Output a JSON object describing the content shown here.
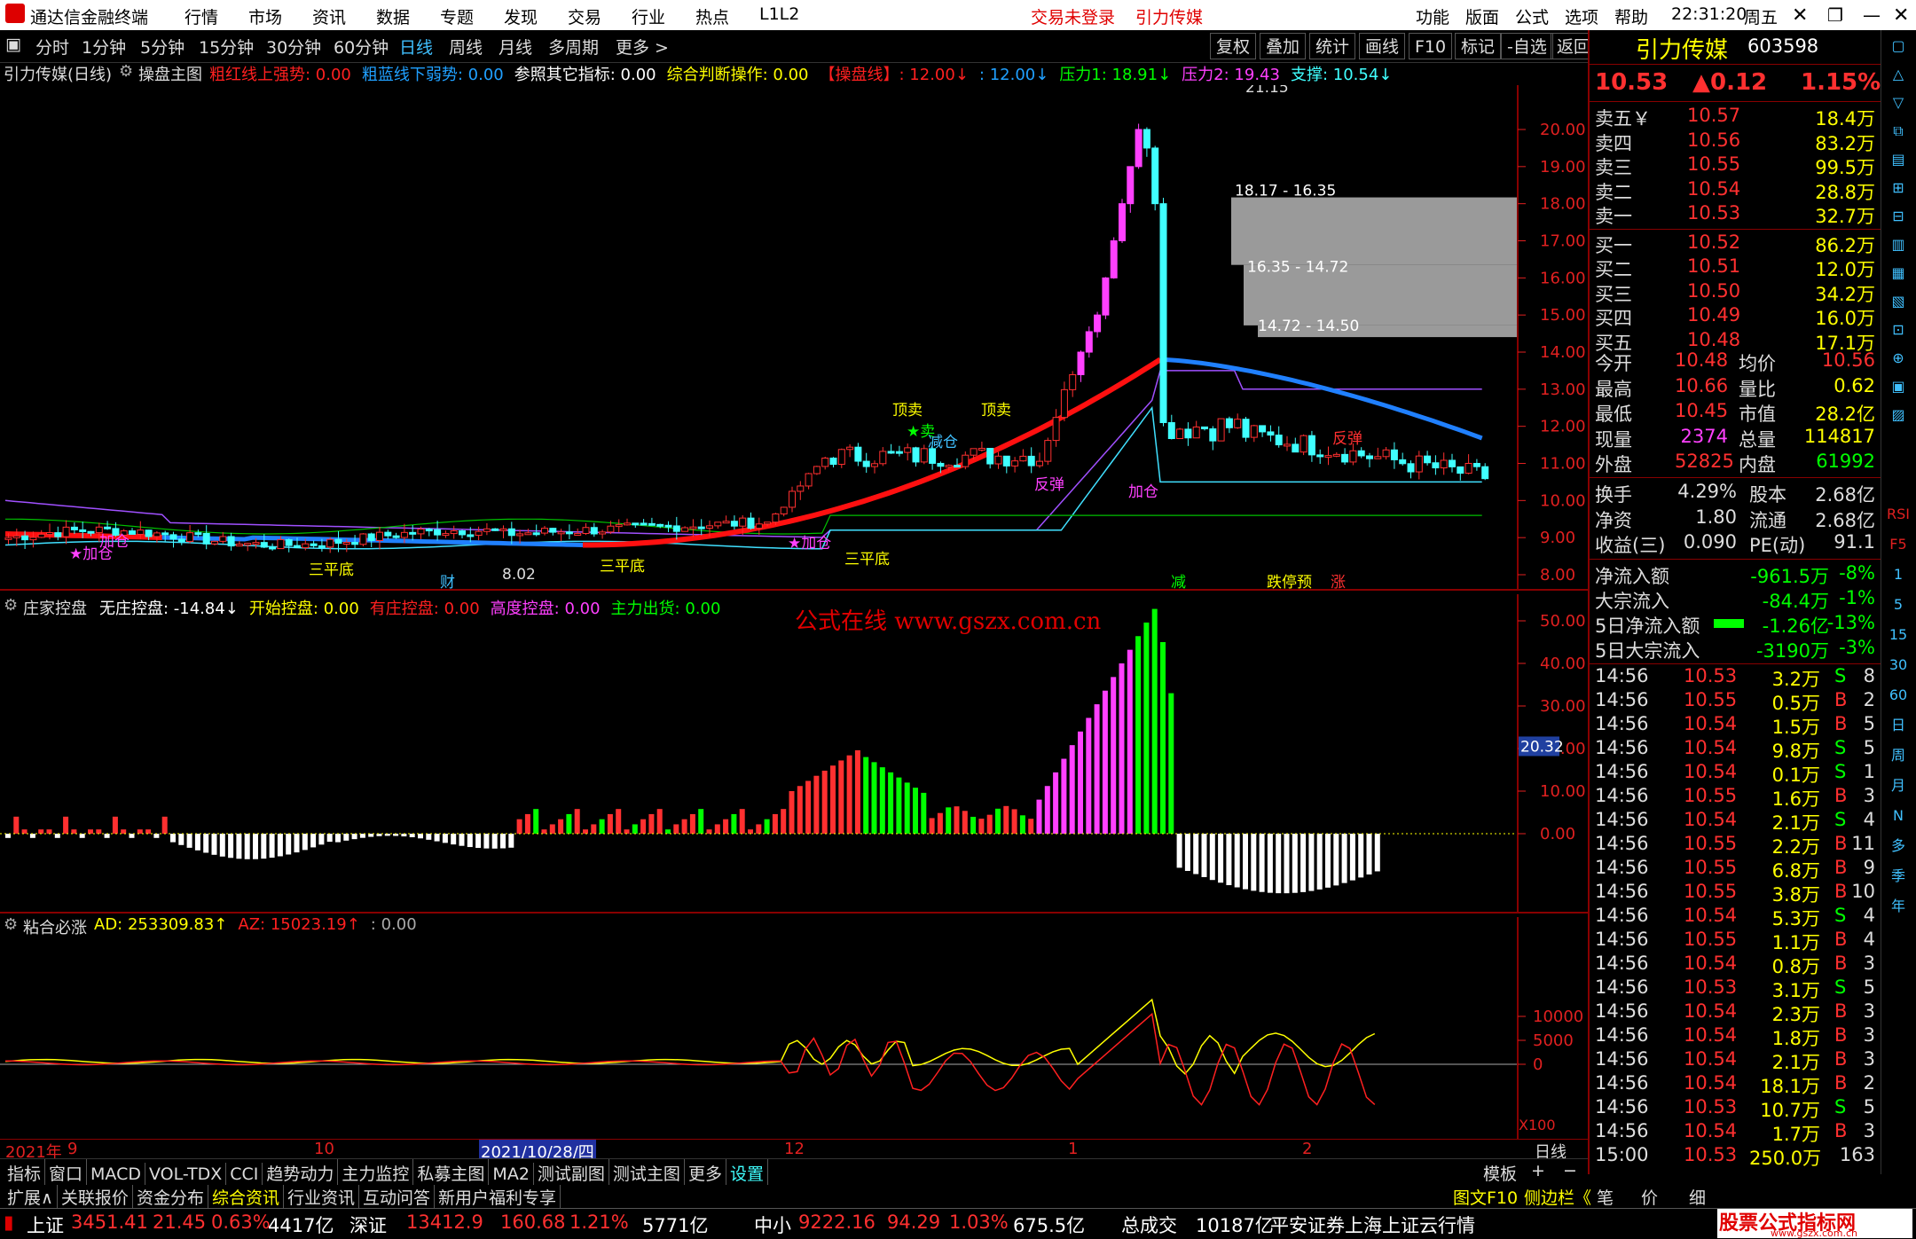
{
  "app": {
    "title": "通达信金融终端",
    "menus": [
      "行情",
      "市场",
      "资讯",
      "数据",
      "专题",
      "发现",
      "交易",
      "行业",
      "热点",
      "L1L2"
    ],
    "trade_status": "交易未登录",
    "stock_name_title": "引力传媒",
    "right_menus": [
      "功能",
      "版面",
      "公式",
      "选项",
      "帮助"
    ],
    "clock": "22:31:20",
    "weekday": "周五"
  },
  "periods": [
    "分时",
    "1分钟",
    "5分钟",
    "15分钟",
    "30分钟",
    "60分钟",
    "日线",
    "周线",
    "月线",
    "多周期",
    "更多 >"
  ],
  "selected_period": "日线",
  "tool_buttons": [
    "复权",
    "叠加",
    "统计",
    "画线",
    "F10",
    "标记",
    "-自选",
    "返回"
  ],
  "main_chart": {
    "title": "引力传媒(日线)",
    "indicator_name": "操盘主图",
    "legend": [
      {
        "text": "粗红线上强势: 0.00",
        "color": "#ff2020"
      },
      {
        "text": "粗蓝线下弱势: 0.00",
        "color": "#20a0ff"
      },
      {
        "text": "参照其它指标: 0.00",
        "color": "#ffffff"
      },
      {
        "text": "综合判断操作: 0.00",
        "color": "#ffff00"
      },
      {
        "text": "【操盘线】: 12.00↓",
        "color": "#ff2020"
      },
      {
        "text": ": 12.00↓",
        "color": "#20a0ff"
      },
      {
        "text": "压力1: 18.91↓",
        "color": "#00ff00"
      },
      {
        "text": "压力2: 19.43",
        "color": "#ff40ff"
      },
      {
        "text": "支撑: 10.54↓",
        "color": "#40ffff"
      }
    ],
    "high_label": "21.15",
    "low_label": "8.02",
    "zones": [
      "18.17 - 16.35",
      "16.35 - 14.72",
      "14.72 - 14.50"
    ],
    "y_ticks": [
      "20.00",
      "19.00",
      "18.00",
      "17.00",
      "16.00",
      "15.00",
      "14.00",
      "13.00",
      "12.00",
      "11.00",
      "10.00",
      "9.00",
      "8.00"
    ],
    "signals": [
      "顶卖",
      "顶卖",
      "★卖",
      "减仓",
      "反弹",
      "加仓",
      "★加仓",
      "加仓",
      "三平底",
      "三平底",
      "三平底",
      "★加仓",
      "反弹",
      "减",
      "跌停预",
      "涨",
      "财"
    ]
  },
  "mid_chart": {
    "indicator_name": "庄家控盘",
    "legend": [
      {
        "text": "无庄控盘: -14.84↓",
        "color": "#ffffff"
      },
      {
        "text": "开始控盘: 0.00",
        "color": "#ffff00"
      },
      {
        "text": "有庄控盘: 0.00",
        "color": "#ff2020"
      },
      {
        "text": "高度控盘: 0.00",
        "color": "#ff40ff"
      },
      {
        "text": "主力出货: 0.00",
        "color": "#00ff00"
      }
    ],
    "watermark": "公式在线 www.gszx.com.cn",
    "y_ticks": [
      "50.00",
      "40.00",
      "30.00",
      "20.00",
      "10.00",
      "0.00"
    ],
    "current_value": "20.32"
  },
  "low_chart": {
    "indicator_name": "粘合必涨",
    "legend": [
      {
        "text": "AD: 253309.83↑",
        "color": "#ffff00"
      },
      {
        "text": "AZ: 15023.19↑",
        "color": "#ff2020"
      },
      {
        "text": ": 0.00",
        "color": "#aaaaaa"
      }
    ],
    "y_ticks": [
      "10000",
      "5000",
      "0"
    ],
    "scale": "X100"
  },
  "x_axis": {
    "labels": [
      "2021年",
      "9",
      "10",
      "2021/10/28/四",
      "12",
      "1",
      "2"
    ],
    "right": "日线"
  },
  "bottom_tabs": [
    "指标",
    "窗口",
    "MACD",
    "VOL-TDX",
    "CCI",
    "趋势动力",
    "主力监控",
    "私募主图",
    "MA2",
    "测试副图",
    "测试主图",
    "更多",
    "设置"
  ],
  "bottom_right": [
    "模板",
    "+",
    "−"
  ],
  "bottom_tabs2": [
    "扩展∧",
    "关联报价",
    "资金分布",
    "综合资讯",
    "行业资讯",
    "互动问答",
    "新用户福利专享"
  ],
  "bottom_right2": [
    "图文F10",
    "侧边栏《",
    "笔",
    "价",
    "细"
  ],
  "quote": {
    "name": "引力传媒",
    "code": "603598",
    "price": "10.53",
    "change": "▲0.12",
    "pct": "1.15%",
    "asks": [
      [
        "卖五￥",
        "10.57",
        "18.4万"
      ],
      [
        "卖四",
        "10.56",
        "83.2万"
      ],
      [
        "卖三",
        "10.55",
        "99.5万"
      ],
      [
        "卖二",
        "10.54",
        "28.8万"
      ],
      [
        "卖一",
        "10.53",
        "32.7万"
      ]
    ],
    "bids": [
      [
        "买一",
        "10.52",
        "86.2万"
      ],
      [
        "买二",
        "10.51",
        "12.0万"
      ],
      [
        "买三",
        "10.50",
        "34.2万"
      ],
      [
        "买四",
        "10.49",
        "16.0万"
      ],
      [
        "买五",
        "10.48",
        "17.1万"
      ]
    ],
    "stats": [
      [
        "今开",
        "10.48",
        "均价",
        "10.56"
      ],
      [
        "最高",
        "10.66",
        "量比",
        "0.62"
      ],
      [
        "最低",
        "10.45",
        "市值",
        "28.2亿"
      ],
      [
        "现量",
        "2374",
        "总量",
        "114817"
      ],
      [
        "外盘",
        "52825",
        "内盘",
        "61992"
      ]
    ],
    "stats2": [
      [
        "换手",
        "4.29%",
        "股本",
        "2.68亿"
      ],
      [
        "净资",
        "1.80",
        "流通",
        "2.68亿"
      ],
      [
        "收益(三)",
        "0.090",
        "PE(动)",
        "91.1"
      ]
    ],
    "flows": [
      [
        "净流入额",
        "-961.5万",
        "-8%"
      ],
      [
        "大宗流入",
        "-84.4万",
        "-1%"
      ],
      [
        "5日净流入额",
        "-1.26亿",
        "-13%"
      ],
      [
        "5日大宗流入",
        "-3190万",
        "-3%"
      ]
    ],
    "ticks": [
      [
        "14:56",
        "10.53",
        "3.2万",
        "S",
        "8"
      ],
      [
        "14:56",
        "10.55",
        "0.5万",
        "B",
        "2"
      ],
      [
        "14:56",
        "10.54",
        "1.5万",
        "B",
        "5"
      ],
      [
        "14:56",
        "10.54",
        "9.8万",
        "S",
        "5"
      ],
      [
        "14:56",
        "10.54",
        "0.1万",
        "S",
        "1"
      ],
      [
        "14:56",
        "10.55",
        "1.6万",
        "B",
        "3"
      ],
      [
        "14:56",
        "10.54",
        "2.1万",
        "S",
        "4"
      ],
      [
        "14:56",
        "10.55",
        "2.2万",
        "B",
        "11"
      ],
      [
        "14:56",
        "10.55",
        "6.8万",
        "B",
        "9"
      ],
      [
        "14:56",
        "10.55",
        "3.8万",
        "B",
        "10"
      ],
      [
        "14:56",
        "10.54",
        "5.3万",
        "S",
        "4"
      ],
      [
        "14:56",
        "10.55",
        "1.1万",
        "B",
        "4"
      ],
      [
        "14:56",
        "10.54",
        "0.8万",
        "B",
        "3"
      ],
      [
        "14:56",
        "10.53",
        "3.1万",
        "S",
        "5"
      ],
      [
        "14:56",
        "10.54",
        "2.3万",
        "B",
        "3"
      ],
      [
        "14:56",
        "10.54",
        "1.8万",
        "B",
        "3"
      ],
      [
        "14:56",
        "10.54",
        "2.1万",
        "B",
        "3"
      ],
      [
        "14:56",
        "10.54",
        "18.1万",
        "B",
        "2"
      ],
      [
        "14:56",
        "10.53",
        "10.7万",
        "S",
        "5"
      ],
      [
        "14:56",
        "10.54",
        "1.7万",
        "B",
        "3"
      ],
      [
        "15:00",
        "10.53",
        "250.0万",
        "",
        "163"
      ]
    ]
  },
  "side_icons": [
    "RSI",
    "F5",
    "1",
    "5",
    "15",
    "30",
    "60",
    "日",
    "周",
    "月",
    "N",
    "多",
    "季",
    "年"
  ],
  "status": {
    "items": [
      {
        "text": "上证",
        "color": "#ffffff"
      },
      {
        "text": "3451.41",
        "color": "#ff3030"
      },
      {
        "text": "21.45",
        "color": "#ff3030"
      },
      {
        "text": "0.63%",
        "color": "#ff3030"
      },
      {
        "text": "4417亿",
        "color": "#ffffff"
      },
      {
        "text": "深证",
        "color": "#ffffff"
      },
      {
        "text": "13412.9",
        "color": "#ff3030"
      },
      {
        "text": "160.68",
        "color": "#ff3030"
      },
      {
        "text": "1.21%",
        "color": "#ff3030"
      },
      {
        "text": "5771亿",
        "color": "#ffffff"
      },
      {
        "text": "中小",
        "color": "#ffffff"
      },
      {
        "text": "9222.16",
        "color": "#ff3030"
      },
      {
        "text": "94.29",
        "color": "#ff3030"
      },
      {
        "text": "1.03%",
        "color": "#ff3030"
      },
      {
        "text": "675.5亿",
        "color": "#ffffff"
      },
      {
        "text": "总成交",
        "color": "#ffffff"
      },
      {
        "text": "10187亿",
        "color": "#ffffff"
      },
      {
        "text": "平安证券上海上证云行情",
        "color": "#ffffff"
      }
    ],
    "brand": "股票公式指标网",
    "brand_url": "www.gszx.com.cn"
  }
}
